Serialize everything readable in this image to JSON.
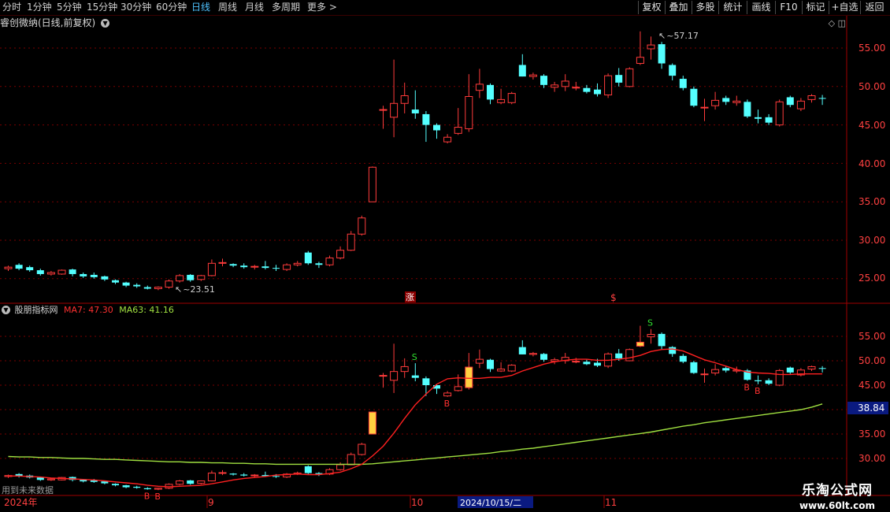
{
  "toolbar": {
    "periods": [
      "分时",
      "1分钟",
      "5分钟",
      "15分钟",
      "30分钟",
      "60分钟",
      "日线",
      "周线",
      "月线",
      "多周期",
      "更多 >"
    ],
    "active_period": "日线",
    "buttons": [
      "复权",
      "叠加",
      "多股",
      "统计",
      "画线",
      "F10",
      "标记",
      "+自选",
      "返回"
    ]
  },
  "main_chart": {
    "title": "睿创微纳(日线,前复权)",
    "high_label": "57.17",
    "low_label": "23.51",
    "zhang_label": "涨",
    "s_label": "$",
    "y_ticks": [
      "55.00",
      "50.00",
      "45.00",
      "40.00",
      "35.00",
      "30.00",
      "25.00"
    ]
  },
  "indicator": {
    "name": "股朋指标网",
    "ma7_label": "MA7: 47.30",
    "ma63_label": "MA63: 41.16",
    "marker_value": "38.84",
    "y_ticks": [
      "55.00",
      "50.00",
      "45.00",
      "35.00",
      "30.00"
    ],
    "hint": "用到未来数据"
  },
  "x_axis": {
    "labels": [
      "2024年",
      "9",
      "10",
      "2024/10/15/二",
      "11"
    ]
  },
  "watermark": {
    "line1": "乐淘公式网",
    "line2": "www.60lt.com"
  },
  "colors": {
    "up": "#ff3b3b",
    "down": "#54ffff",
    "ma7": "#ff2020",
    "ma63": "#a0e040",
    "grid": "#7a0000",
    "axis_text": "#ff4040",
    "active": "#4fc3ff"
  },
  "chart_data": {
    "type": "candlestick",
    "candles": [
      {
        "o": 26.3,
        "c": 26.5,
        "h": 26.7,
        "l": 26.0
      },
      {
        "o": 26.8,
        "c": 26.3,
        "h": 27.0,
        "l": 26.1
      },
      {
        "o": 26.5,
        "c": 26.1,
        "h": 26.7,
        "l": 25.9
      },
      {
        "o": 26.1,
        "c": 25.6,
        "h": 26.3,
        "l": 25.4
      },
      {
        "o": 25.6,
        "c": 25.8,
        "h": 26.0,
        "l": 25.4
      },
      {
        "o": 25.6,
        "c": 26.1,
        "h": 26.2,
        "l": 25.5
      },
      {
        "o": 26.2,
        "c": 25.6,
        "h": 26.3,
        "l": 25.3
      },
      {
        "o": 25.6,
        "c": 25.3,
        "h": 25.8,
        "l": 25.1
      },
      {
        "o": 25.5,
        "c": 25.2,
        "h": 25.8,
        "l": 25.0
      },
      {
        "o": 25.3,
        "c": 24.9,
        "h": 25.4,
        "l": 24.7
      },
      {
        "o": 24.8,
        "c": 24.5,
        "h": 24.9,
        "l": 24.3
      },
      {
        "o": 24.5,
        "c": 24.1,
        "h": 24.6,
        "l": 23.9
      },
      {
        "o": 24.2,
        "c": 24.0,
        "h": 24.4,
        "l": 23.8
      },
      {
        "o": 23.9,
        "c": 23.7,
        "h": 24.1,
        "l": 23.6
      },
      {
        "o": 23.7,
        "c": 23.9,
        "h": 24.0,
        "l": 23.51
      },
      {
        "o": 23.9,
        "c": 24.7,
        "h": 24.9,
        "l": 23.7
      },
      {
        "o": 24.7,
        "c": 25.4,
        "h": 25.6,
        "l": 24.5
      },
      {
        "o": 25.5,
        "c": 24.8,
        "h": 25.6,
        "l": 24.6
      },
      {
        "o": 24.9,
        "c": 25.4,
        "h": 25.5,
        "l": 24.7
      },
      {
        "o": 25.4,
        "c": 27.0,
        "h": 27.5,
        "l": 25.3
      },
      {
        "o": 27.0,
        "c": 27.1,
        "h": 27.6,
        "l": 26.6
      },
      {
        "o": 26.9,
        "c": 26.7,
        "h": 27.0,
        "l": 26.5
      },
      {
        "o": 26.7,
        "c": 26.5,
        "h": 27.0,
        "l": 26.3
      },
      {
        "o": 26.5,
        "c": 26.6,
        "h": 26.8,
        "l": 26.2
      },
      {
        "o": 26.6,
        "c": 26.4,
        "h": 27.3,
        "l": 26.2
      },
      {
        "o": 26.4,
        "c": 26.3,
        "h": 26.8,
        "l": 26.0
      },
      {
        "o": 26.2,
        "c": 26.8,
        "h": 27.0,
        "l": 26.0
      },
      {
        "o": 26.8,
        "c": 27.0,
        "h": 27.3,
        "l": 26.6
      },
      {
        "o": 28.4,
        "c": 27.0,
        "h": 28.6,
        "l": 26.8
      },
      {
        "o": 27.0,
        "c": 26.8,
        "h": 27.2,
        "l": 26.4
      },
      {
        "o": 26.8,
        "c": 27.7,
        "h": 28.0,
        "l": 26.6
      },
      {
        "o": 27.7,
        "c": 28.7,
        "h": 29.2,
        "l": 27.5
      },
      {
        "o": 28.7,
        "c": 30.8,
        "h": 31.2,
        "l": 28.6
      },
      {
        "o": 30.8,
        "c": 32.9,
        "h": 33.2,
        "l": 30.6
      },
      {
        "o": 35.0,
        "c": 39.5,
        "h": 39.6,
        "l": 35.0
      },
      {
        "o": 47.0,
        "c": 47.0,
        "h": 47.5,
        "l": 44.5
      },
      {
        "o": 46.0,
        "c": 47.8,
        "h": 53.5,
        "l": 43.4
      },
      {
        "o": 47.8,
        "c": 48.8,
        "h": 50.5,
        "l": 46.5
      },
      {
        "o": 47.0,
        "c": 46.5,
        "h": 49.5,
        "l": 45.8
      },
      {
        "o": 46.4,
        "c": 45.0,
        "h": 46.8,
        "l": 42.8
      },
      {
        "o": 45.0,
        "c": 44.3,
        "h": 45.2,
        "l": 43.2
      },
      {
        "o": 42.8,
        "c": 43.4,
        "h": 43.8,
        "l": 42.6
      },
      {
        "o": 43.9,
        "c": 44.7,
        "h": 47.2,
        "l": 43.7
      },
      {
        "o": 44.5,
        "c": 48.7,
        "h": 51.6,
        "l": 44.1
      },
      {
        "o": 49.5,
        "c": 50.3,
        "h": 52.3,
        "l": 48.5
      },
      {
        "o": 50.2,
        "c": 48.3,
        "h": 50.4,
        "l": 47.7
      },
      {
        "o": 47.9,
        "c": 48.3,
        "h": 49.7,
        "l": 47.7
      },
      {
        "o": 47.9,
        "c": 49.1,
        "h": 49.3,
        "l": 47.7
      },
      {
        "o": 52.8,
        "c": 51.3,
        "h": 54.2,
        "l": 51.3
      },
      {
        "o": 51.3,
        "c": 51.5,
        "h": 51.8,
        "l": 50.9
      },
      {
        "o": 51.4,
        "c": 50.2,
        "h": 51.6,
        "l": 49.8
      },
      {
        "o": 49.9,
        "c": 50.2,
        "h": 50.6,
        "l": 49.3
      },
      {
        "o": 50.0,
        "c": 50.7,
        "h": 51.6,
        "l": 49.4
      },
      {
        "o": 49.8,
        "c": 49.9,
        "h": 50.6,
        "l": 49.5
      },
      {
        "o": 49.8,
        "c": 49.3,
        "h": 50.2,
        "l": 49.1
      },
      {
        "o": 49.6,
        "c": 49.0,
        "h": 50.4,
        "l": 48.7
      },
      {
        "o": 48.9,
        "c": 51.4,
        "h": 51.7,
        "l": 48.5
      },
      {
        "o": 51.5,
        "c": 50.5,
        "h": 52.4,
        "l": 50.0
      },
      {
        "o": 50.0,
        "c": 52.3,
        "h": 52.5,
        "l": 49.9
      },
      {
        "o": 53.0,
        "c": 53.8,
        "h": 57.17,
        "l": 52.8
      },
      {
        "o": 54.9,
        "c": 55.4,
        "h": 56.5,
        "l": 53.5
      },
      {
        "o": 55.5,
        "c": 53.0,
        "h": 55.8,
        "l": 52.3
      },
      {
        "o": 52.8,
        "c": 51.4,
        "h": 53.0,
        "l": 50.8
      },
      {
        "o": 51.0,
        "c": 49.8,
        "h": 51.4,
        "l": 49.5
      },
      {
        "o": 49.7,
        "c": 47.5,
        "h": 50.0,
        "l": 47.3
      },
      {
        "o": 47.2,
        "c": 47.3,
        "h": 48.4,
        "l": 45.5
      },
      {
        "o": 47.5,
        "c": 48.2,
        "h": 49.3,
        "l": 47.0
      },
      {
        "o": 48.5,
        "c": 48.0,
        "h": 48.8,
        "l": 47.6
      },
      {
        "o": 47.9,
        "c": 48.1,
        "h": 48.8,
        "l": 47.5
      },
      {
        "o": 48.0,
        "c": 46.1,
        "h": 48.3,
        "l": 45.9
      },
      {
        "o": 46.0,
        "c": 45.8,
        "h": 47.0,
        "l": 45.2
      },
      {
        "o": 46.0,
        "c": 45.3,
        "h": 46.4,
        "l": 45.0
      },
      {
        "o": 45.0,
        "c": 48.0,
        "h": 48.3,
        "l": 44.8
      },
      {
        "o": 48.6,
        "c": 47.6,
        "h": 48.8,
        "l": 47.3
      },
      {
        "o": 47.1,
        "c": 48.1,
        "h": 48.5,
        "l": 46.8
      },
      {
        "o": 48.3,
        "c": 48.8,
        "h": 49.0,
        "l": 47.9
      },
      {
        "o": 48.5,
        "c": 48.4,
        "h": 48.9,
        "l": 47.6
      }
    ],
    "ma7_values": [
      26.4,
      26.4,
      26.3,
      26.2,
      26.0,
      25.9,
      25.8,
      25.7,
      25.6,
      25.4,
      25.2,
      25.0,
      24.8,
      24.5,
      24.3,
      24.2,
      24.3,
      24.4,
      24.5,
      24.8,
      25.2,
      25.6,
      25.9,
      26.1,
      26.3,
      26.6,
      26.7,
      26.8,
      26.7,
      26.7,
      26.9,
      27.2,
      27.9,
      28.8,
      30.5,
      32.5,
      35.2,
      38.2,
      41.0,
      43.2,
      45.2,
      46.3,
      46.5,
      46.4,
      46.4,
      46.6,
      46.6,
      47.0,
      47.9,
      48.6,
      49.3,
      49.8,
      50.1,
      50.3,
      50.3,
      50.1,
      50.1,
      50.3,
      50.6,
      51.1,
      51.9,
      52.3,
      52.4,
      52.0,
      51.1,
      50.2,
      49.6,
      48.9,
      48.2,
      47.7,
      47.5,
      47.4,
      47.2,
      47.2,
      47.3,
      47.3,
      47.3
    ],
    "ma63_values": [
      30.4,
      30.3,
      30.3,
      30.2,
      30.2,
      30.1,
      30.0,
      30.0,
      29.9,
      29.8,
      29.8,
      29.7,
      29.6,
      29.5,
      29.4,
      29.3,
      29.3,
      29.2,
      29.2,
      29.1,
      29.1,
      29.0,
      29.0,
      28.9,
      28.9,
      28.8,
      28.8,
      28.8,
      28.8,
      28.8,
      28.8,
      28.8,
      28.8,
      28.8,
      28.9,
      29.1,
      29.3,
      29.5,
      29.7,
      29.9,
      30.1,
      30.3,
      30.5,
      30.7,
      30.9,
      31.1,
      31.4,
      31.6,
      31.9,
      32.1,
      32.4,
      32.7,
      33.0,
      33.3,
      33.6,
      33.9,
      34.2,
      34.5,
      34.8,
      35.1,
      35.4,
      35.8,
      36.2,
      36.6,
      36.9,
      37.3,
      37.6,
      37.9,
      38.2,
      38.5,
      38.8,
      39.1,
      39.4,
      39.7,
      40.0,
      40.5,
      41.16
    ],
    "b_marks": [
      13,
      14,
      41,
      69,
      70
    ],
    "s_marks": [
      38,
      60
    ]
  }
}
